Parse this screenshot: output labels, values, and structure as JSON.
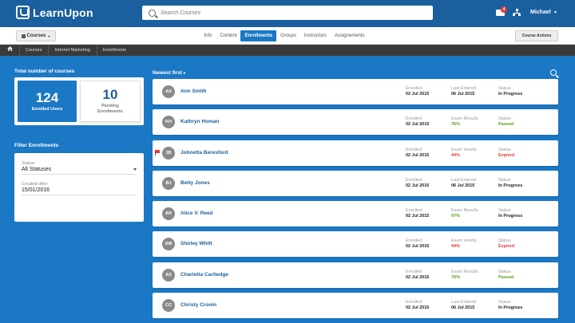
{
  "header": {
    "logo": "LearnUpon",
    "search_placeholder": "Search Courses",
    "mail_count": "4",
    "user": "Michael"
  },
  "subnav": {
    "courses_button": "Courses",
    "tabs": [
      {
        "label": "Info",
        "active": false
      },
      {
        "label": "Content",
        "active": false
      },
      {
        "label": "Enrollments",
        "active": true
      },
      {
        "label": "Groups",
        "active": false
      },
      {
        "label": "Instructors",
        "active": false
      },
      {
        "label": "Assignements",
        "active": false
      }
    ],
    "course_actions": "Course Actions"
  },
  "breadcrumb": [
    "Courses",
    "Internet Marketing",
    "Enrollments"
  ],
  "totals": {
    "title": "Total number of courses",
    "enrolled_count": "124",
    "enrolled_label": "Enrolled Users",
    "pending_count": "10",
    "pending_label": "Pending Enrollments"
  },
  "filters": {
    "title": "Filter Enrollments",
    "status_label": "Status:",
    "status_value": "All Statuses",
    "created_label": "Created after:",
    "created_value": "15/01/2016"
  },
  "list": {
    "sort": "Newest first",
    "rows": [
      {
        "initials": "AS",
        "name": "Ann Smith",
        "flag": false,
        "enrolled_label": "Enrolled",
        "enrolled": "02 Jul 2015",
        "mid_label": "Last Entered",
        "mid": "06 Jul 2015",
        "mid_color": "",
        "status_label": "Status",
        "status": "In Progress",
        "status_color": ""
      },
      {
        "initials": "KH",
        "name": "Kathryn Homan",
        "flag": false,
        "enrolled_label": "Enrolled",
        "enrolled": "02 Jul 2015",
        "mid_label": "Exam Results",
        "mid": "76%",
        "mid_color": "green",
        "status_label": "Status",
        "status": "Passed",
        "status_color": "green"
      },
      {
        "initials": "JB",
        "name": "Johnetta Beresford",
        "flag": true,
        "enrolled_label": "Enrolled",
        "enrolled": "02 Jul 2015",
        "mid_label": "Exam results",
        "mid": "44%",
        "mid_color": "red",
        "status_label": "Status",
        "status": "Expired",
        "status_color": "red"
      },
      {
        "initials": "BJ",
        "name": "Betty Jones",
        "flag": false,
        "enrolled_label": "Enrolled",
        "enrolled": "02 Jul 2015",
        "mid_label": "Last Entered",
        "mid": "06 Jul 2015",
        "mid_color": "",
        "status_label": "Status",
        "status": "In Progress",
        "status_color": ""
      },
      {
        "initials": "AR",
        "name": "Alice V. Reed",
        "flag": false,
        "enrolled_label": "Enrolled",
        "enrolled": "02 Jul 2015",
        "mid_label": "Exam Results",
        "mid": "97%",
        "mid_color": "green",
        "status_label": "Status",
        "status": "In Progress",
        "status_color": ""
      },
      {
        "initials": "SW",
        "name": "Shirley Whitt",
        "flag": false,
        "enrolled_label": "Enrolled",
        "enrolled": "02 Jul 2015",
        "mid_label": "Exam results",
        "mid": "44%",
        "mid_color": "red",
        "status_label": "Status",
        "status": "Expired",
        "status_color": "red"
      },
      {
        "initials": "AS",
        "name": "Charletta Cartledge",
        "flag": false,
        "enrolled_label": "Enrolled",
        "enrolled": "02 Jul 2015",
        "mid_label": "Exam Results",
        "mid": "76%",
        "mid_color": "green",
        "status_label": "Status",
        "status": "Passed",
        "status_color": "green"
      },
      {
        "initials": "CC",
        "name": "Christy Cronin",
        "flag": false,
        "enrolled_label": "Enrolled",
        "enrolled": "02 Jul 2015",
        "mid_label": "Last Entered",
        "mid": "06 Jul 2015",
        "mid_color": "",
        "status_label": "Status",
        "status": "In Progress",
        "status_color": ""
      }
    ]
  }
}
